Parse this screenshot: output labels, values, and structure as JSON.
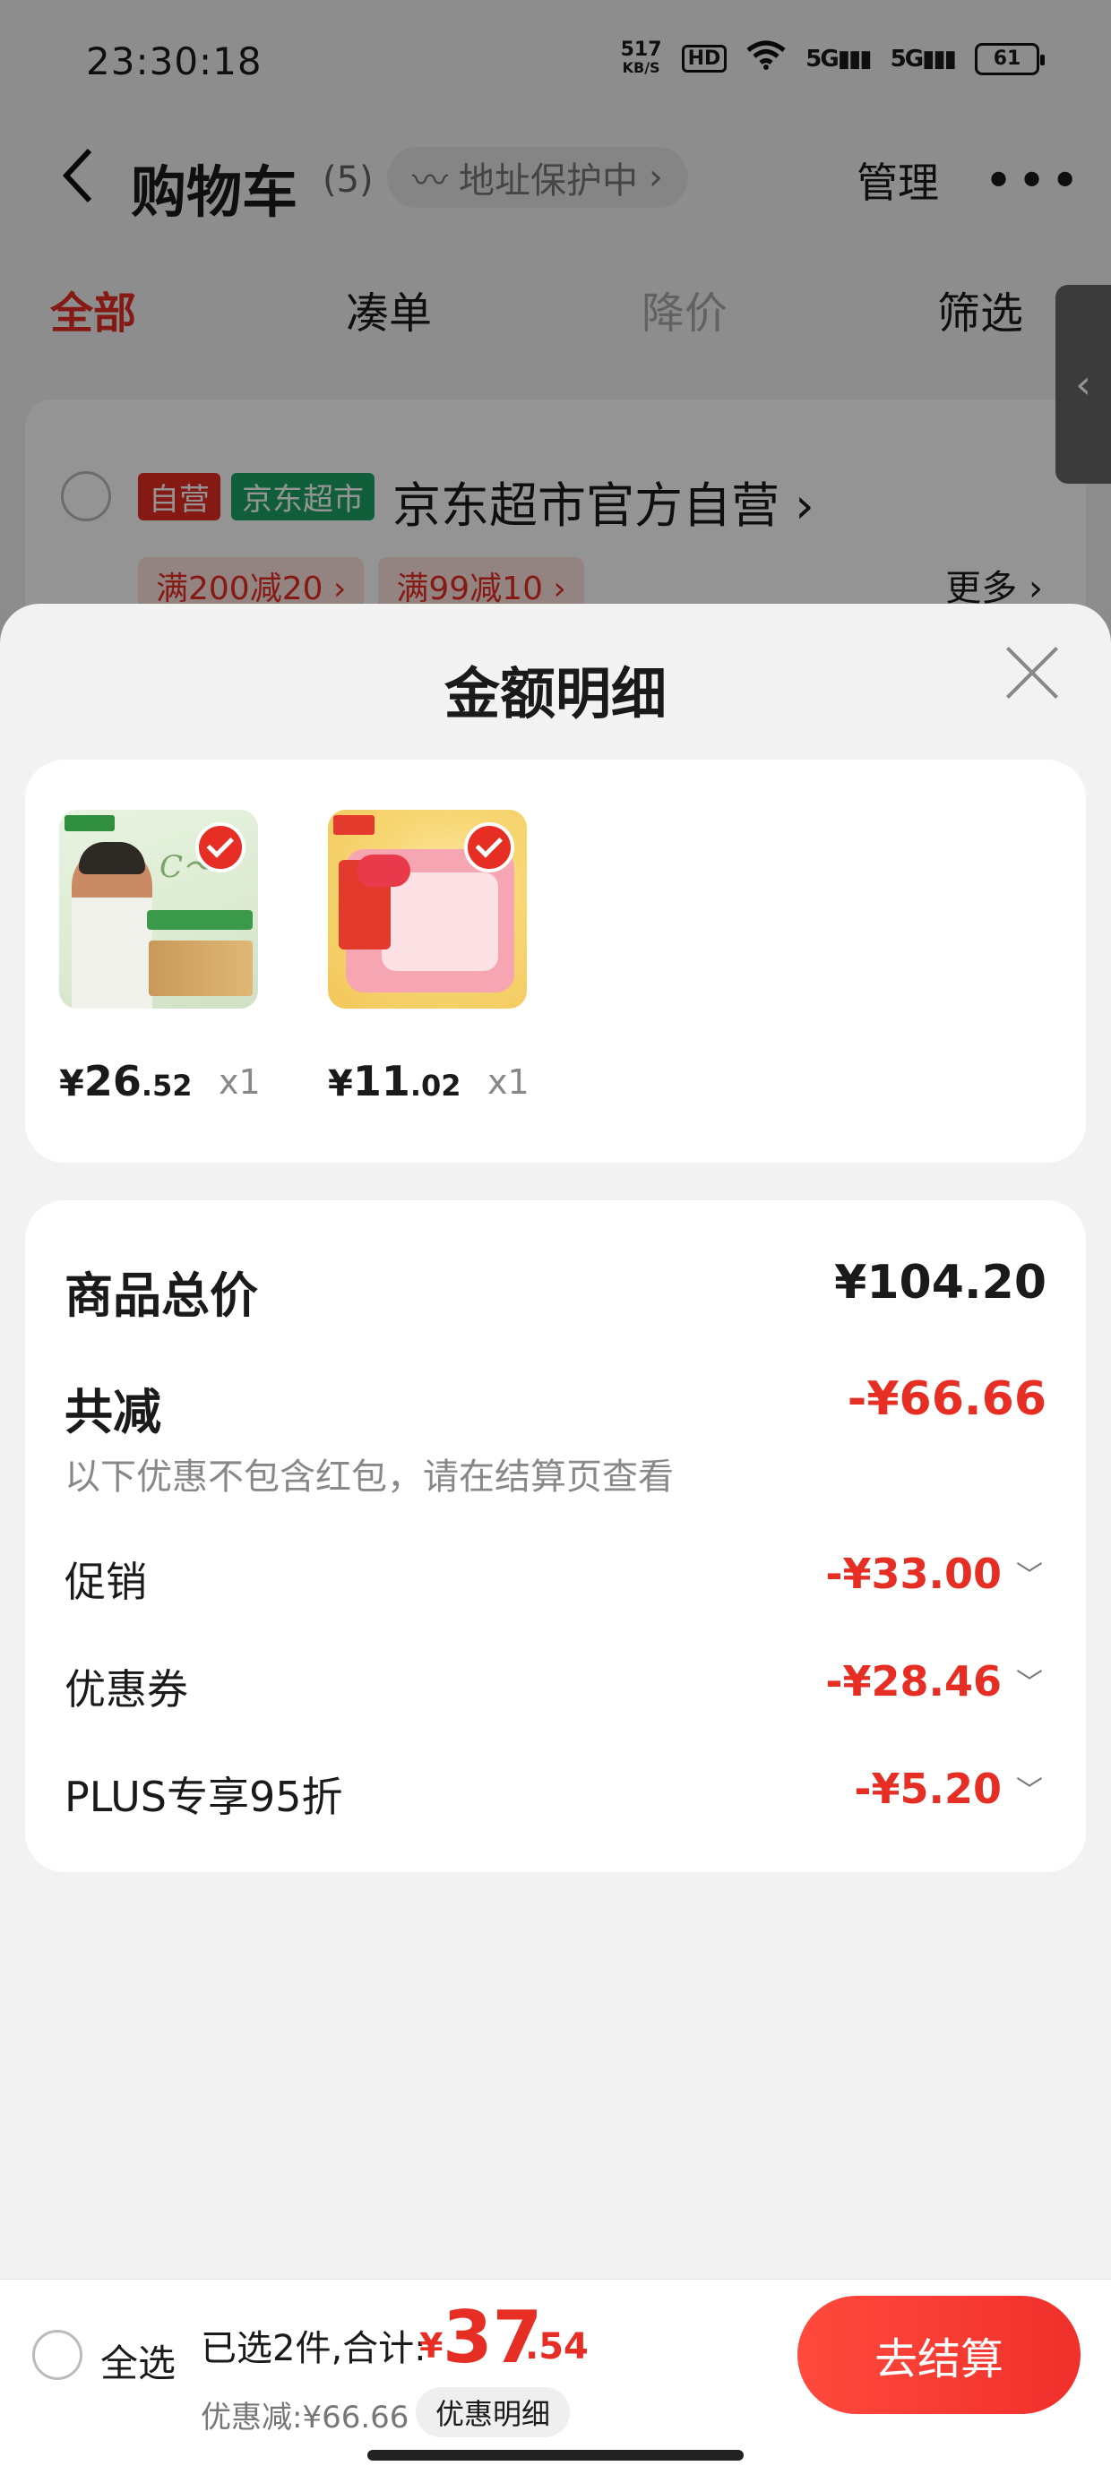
{
  "status_bar": {
    "time": "23:30:18",
    "net_speed": "517",
    "net_unit": "KB/S",
    "hd": "HD",
    "sig1": "5G",
    "sig2": "5G",
    "battery": "61"
  },
  "nav": {
    "back": "‹",
    "title": "购物车",
    "count": "(5)",
    "address": "地址保护中",
    "address_chevron": "›",
    "manage": "管理",
    "more": "•••"
  },
  "tabs": [
    "全部",
    "凑单",
    "降价",
    "筛选"
  ],
  "store": {
    "tag_self": "自营",
    "tag_market": "京东超市",
    "name": "京东超市官方自营",
    "name_chevron": "›",
    "promos": [
      "满200减20 ›",
      "满99减10 ›"
    ],
    "more": "更多 ›"
  },
  "side_handle": "‹",
  "sheet": {
    "title": "金额明细",
    "items": [
      {
        "yen": "¥",
        "int": "26",
        "dec": ".52",
        "qty": "x1"
      },
      {
        "yen": "¥",
        "int": "11",
        "dec": ".02",
        "qty": "x1"
      }
    ],
    "summary": {
      "total_label": "商品总价",
      "total_value": "¥104.20",
      "reduce_label": "共减",
      "reduce_value": "-¥66.66",
      "reduce_note": "以下优惠不包含红包，请在结算页查看",
      "lines": [
        {
          "label": "促销",
          "value": "-¥33.00"
        },
        {
          "label": "优惠券",
          "value": "-¥28.46"
        },
        {
          "label": "PLUS专享95折",
          "value": "-¥5.20"
        }
      ]
    }
  },
  "checkout": {
    "select_all": "全选",
    "selected_text": "已选2件,合计:",
    "sum_yen": "¥",
    "sum_int": "37",
    "sum_dec": ".54",
    "discount_text": "优惠减:¥66.66",
    "detail_button": "优惠明细",
    "checkout_button": "去结算"
  },
  "colors": {
    "accent": "#e62e24",
    "market_green": "#1ea365"
  }
}
